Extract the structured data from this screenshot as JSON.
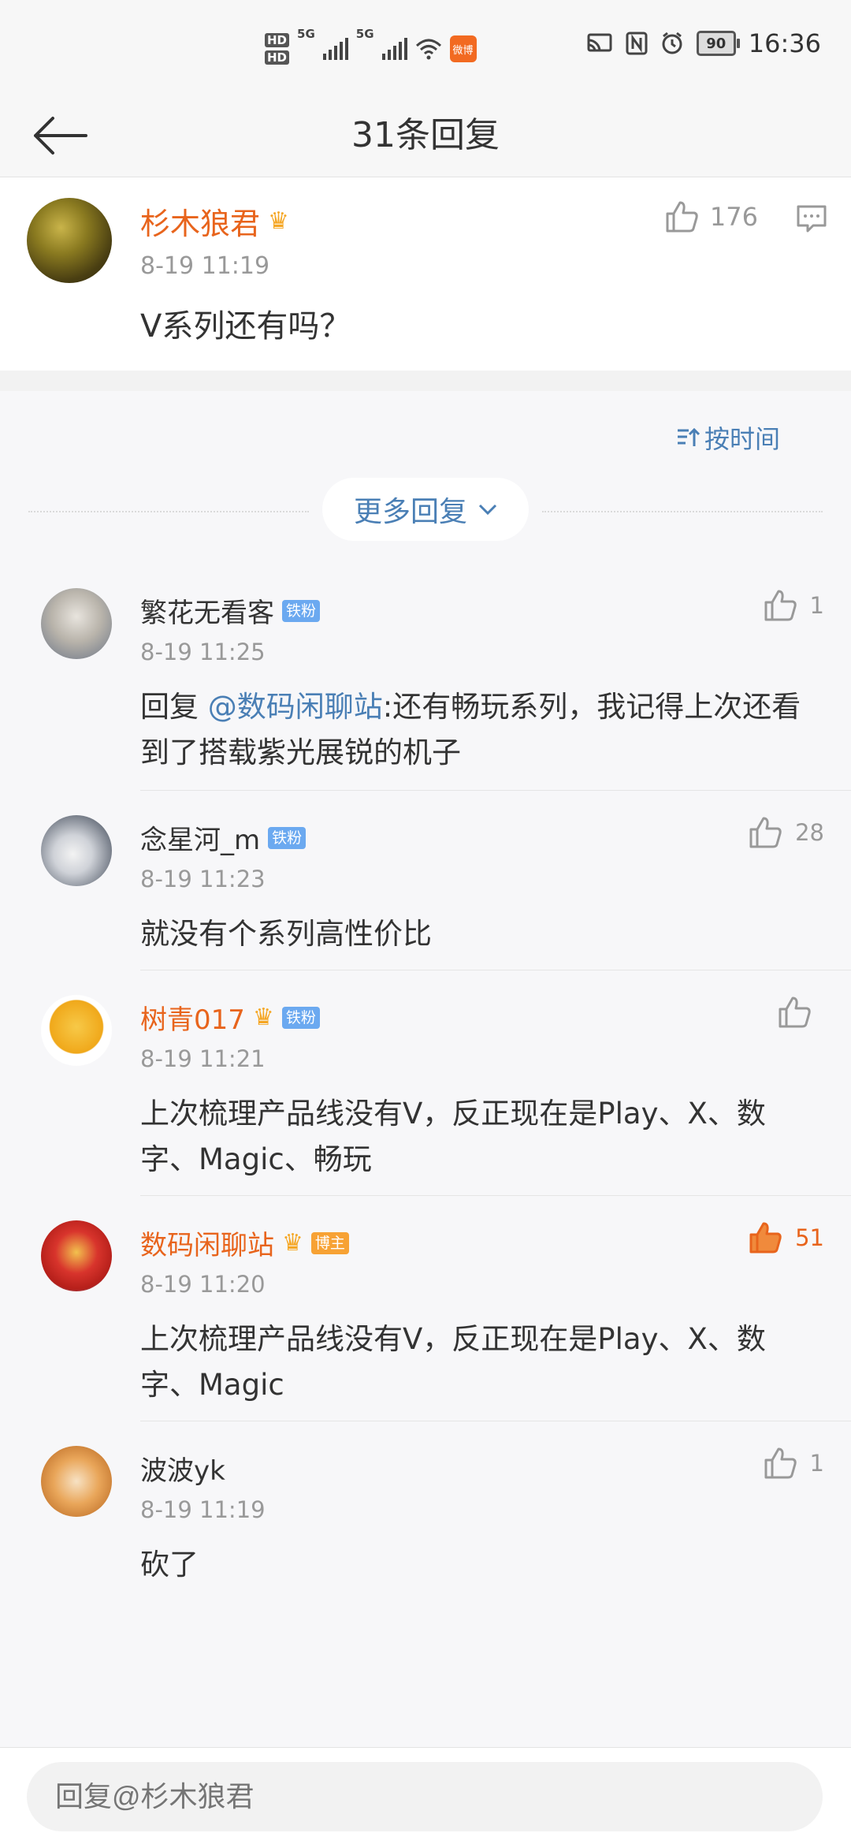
{
  "status_bar": {
    "hd1": "HD",
    "hd2": "HD",
    "net1": "5G",
    "net2": "5G",
    "app_badge": "微博",
    "battery": "90",
    "time": "16:36"
  },
  "header": {
    "title": "31条回复"
  },
  "original_comment": {
    "author": "杉木狼君",
    "time": "8-19 11:19",
    "text": "V系列还有吗？",
    "likes": "176"
  },
  "controls": {
    "sort_label": "按时间",
    "more_replies": "更多回复"
  },
  "replies": [
    {
      "author": "繁花无看客",
      "badge": "铁粉",
      "time": "8-19 11:25",
      "prefix": "回复 ",
      "mention": "@数码闲聊站",
      "text": ":还有畅玩系列，我记得上次还看到了搭载紫光展锐的机子",
      "likes": "1"
    },
    {
      "author": "念星河_m",
      "badge": "铁粉",
      "time": "8-19 11:23",
      "text": "就没有个系列高性价比",
      "likes": "28"
    },
    {
      "author": "树青017",
      "badge": "铁粉",
      "time": "8-19 11:21",
      "text": "上次梳理产品线没有V，反正现在是Play、X、数字、Magic、畅玩",
      "likes": ""
    },
    {
      "author": "数码闲聊站",
      "badge": "博主",
      "time": "8-19 11:20",
      "text": "上次梳理产品线没有V，反正现在是Play、X、数字、Magic",
      "likes": "51"
    },
    {
      "author": "波波yk",
      "time": "8-19 11:19",
      "text": "砍了",
      "likes": "1"
    }
  ],
  "input": {
    "placeholder": "回复@杉木狼君"
  },
  "colors": {
    "accent_orange": "#e8641c",
    "link_blue": "#4a7fb5",
    "iron_fan_badge": "#6ba9f0",
    "blogger_badge": "#f7a234"
  }
}
